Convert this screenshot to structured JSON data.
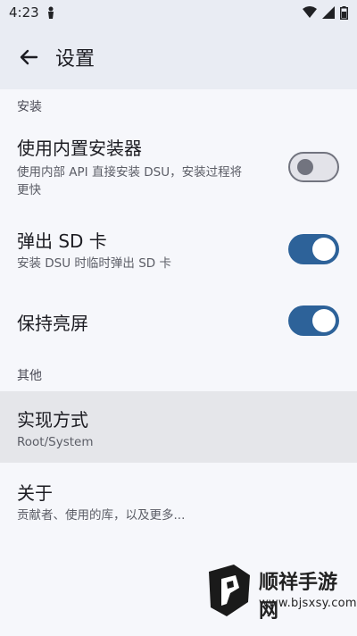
{
  "status_bar": {
    "time": "4:23",
    "icons": [
      "person-notification-icon",
      "wifi-icon",
      "signal-icon",
      "battery-icon"
    ]
  },
  "app_bar": {
    "title": "设置",
    "back_icon": "arrow-left-icon"
  },
  "sections": {
    "install": {
      "header": "安装",
      "builtin_installer": {
        "title": "使用内置安装器",
        "subtitle_line1": "使用内部 API 直接安装 DSU，安装过程将",
        "subtitle_line2": "更快",
        "enabled": false
      },
      "eject_sd": {
        "title": "弹出 SD 卡",
        "subtitle": "安装 DSU 时临时弹出 SD 卡",
        "enabled": true
      },
      "keep_screen_on": {
        "title": "保持亮屏",
        "enabled": true
      }
    },
    "other": {
      "header": "其他",
      "implementation": {
        "title": "实现方式",
        "subtitle": "Root/System"
      },
      "about": {
        "title": "关于",
        "subtitle": "贡献者、使用的库，以及更多..."
      }
    }
  },
  "watermark": {
    "name": "顺祥手游网",
    "url": "www.bjsxsy.com"
  },
  "colors": {
    "toggle_on": "#2d6299",
    "toggle_off_track": "#e3e3e9",
    "toggle_off_outline": "#72747f",
    "app_bar": "#e9ecf3",
    "background": "#f6f7fb",
    "highlight": "#e5e6ea"
  }
}
